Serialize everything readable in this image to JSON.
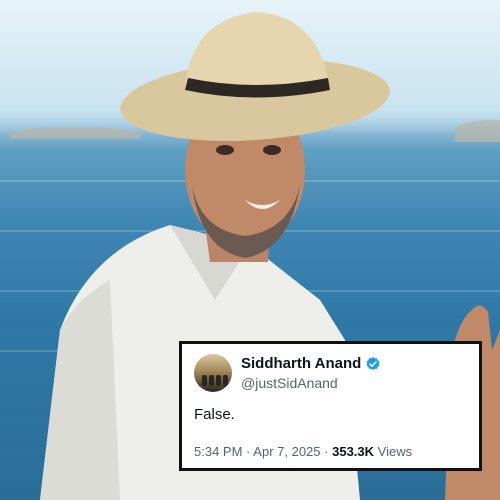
{
  "tweet": {
    "display_name": "Siddharth Anand",
    "handle": "@justSidAnand",
    "text": "False.",
    "time": "5:34 PM",
    "separator": "·",
    "date": "Apr 7, 2025",
    "views_count": "353.3K",
    "views_label": "Views"
  },
  "colors": {
    "verified": "#1d9bf0",
    "text_primary": "#0f1419",
    "text_secondary": "#536471",
    "card_border": "#111111"
  },
  "icons": {
    "verified": "verified-badge-icon",
    "avatar": "avatar"
  }
}
